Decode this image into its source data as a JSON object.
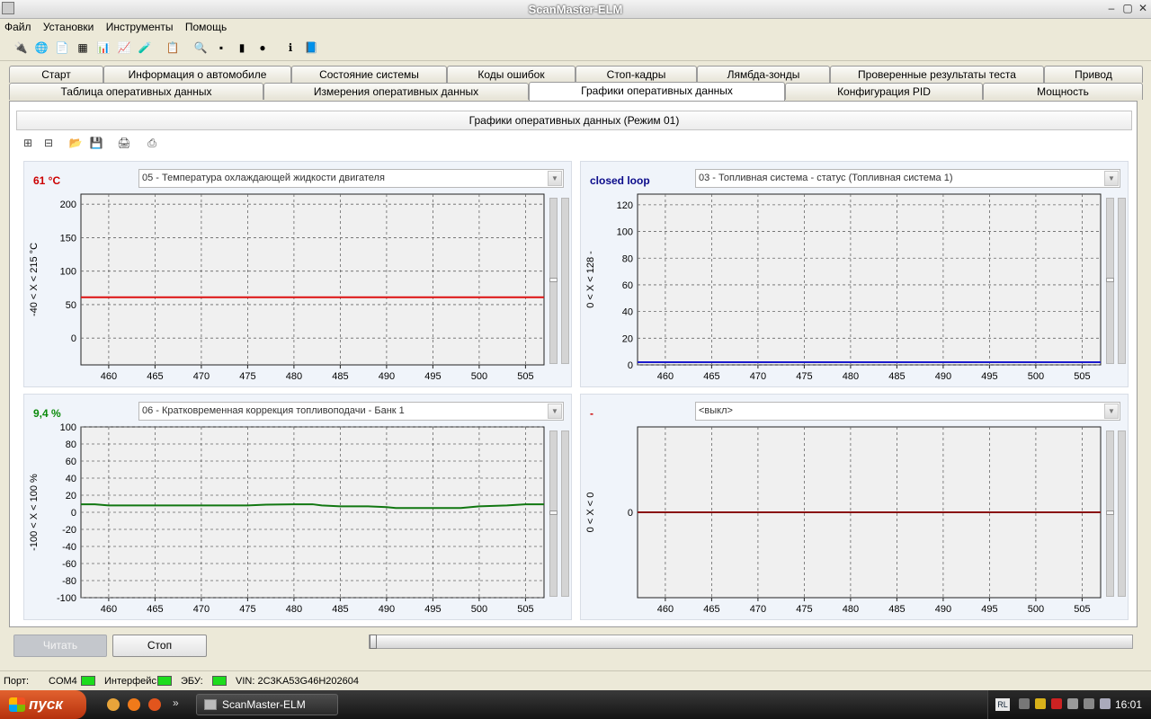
{
  "window": {
    "title": "ScanMaster-ELM"
  },
  "menu": [
    "Файл",
    "Установки",
    "Инструменты",
    "Помощь"
  ],
  "tabs_row1": [
    "Старт",
    "Информация о автомобиле",
    "Состояние системы",
    "Коды ошибок",
    "Стоп-кадры",
    "Лямбда-зонды",
    "Проверенные результаты теста",
    "Привод"
  ],
  "tabs_row2": [
    "Таблица оперативных данных",
    "Измерения оперативных данных",
    "Графики оперативных данных",
    "Конфигурация PID",
    "Мощность"
  ],
  "active_tab": "Графики оперативных данных",
  "panel_title": "Графики оперативных данных (Режим 01)",
  "x_ticks": [
    "460",
    "465",
    "470",
    "475",
    "480",
    "485",
    "490",
    "495",
    "500",
    "505"
  ],
  "graphs": [
    {
      "value": "61 °C",
      "value_color": "#cc0000",
      "pid": "05 - Температура охлаждающей жидкости двигателя",
      "range_label": "-40  < X <  215 °C",
      "y_ticks": [
        "200",
        "150",
        "100",
        "50",
        "0"
      ],
      "line_color": "#dd1111"
    },
    {
      "value": "closed loop",
      "value_color": "#0a0a8a",
      "pid": "03 - Топливная система - статус (Топливная система 1)",
      "range_label": "0  < X <  128  -",
      "y_ticks": [
        "120",
        "100",
        "80",
        "60",
        "40",
        "20",
        "0"
      ],
      "line_color": "#1a1acc"
    },
    {
      "value": "9,4 %",
      "value_color": "#0a8a0a",
      "pid": "06 - Кратковременная коррекция топливоподачи - Банк 1",
      "range_label": "-100  < X <  100  %",
      "y_ticks": [
        "100",
        "80",
        "60",
        "40",
        "20",
        "0",
        "-20",
        "-40",
        "-60",
        "-80",
        "-100"
      ],
      "line_color": "#117711"
    },
    {
      "value": "-",
      "value_color": "#cc0000",
      "pid": "<выкл>",
      "range_label": "0  < X <  0",
      "y_ticks": [
        "0"
      ],
      "line_color": "#8a1010"
    }
  ],
  "chart_data": [
    {
      "type": "line",
      "title": "05 - Температура охлаждающей жидкости двигателя",
      "ylabel": "-40  < X <  215 °C",
      "xlim": [
        457,
        507
      ],
      "ylim": [
        -40,
        215
      ],
      "grid": true,
      "series": [
        {
          "x": [
            457,
            507
          ],
          "values": [
            61,
            61
          ]
        }
      ]
    },
    {
      "type": "line",
      "title": "03 - Топливная система - статус (Топливная система 1)",
      "ylabel": "0  < X <  128  -",
      "xlim": [
        457,
        507
      ],
      "ylim": [
        0,
        128
      ],
      "grid": true,
      "series": [
        {
          "x": [
            457,
            507
          ],
          "values": [
            2,
            2
          ]
        }
      ]
    },
    {
      "type": "line",
      "title": "06 - Кратковременная коррекция топливоподачи - Банк 1",
      "ylabel": "-100  < X <  100  %",
      "xlim": [
        457,
        507
      ],
      "ylim": [
        -100,
        100
      ],
      "grid": true,
      "series": [
        {
          "x": [
            457,
            458.5,
            460,
            465,
            470,
            475,
            477,
            480,
            482,
            483,
            485,
            488,
            490,
            491,
            495,
            498,
            500,
            503,
            505,
            507
          ],
          "values": [
            9.4,
            9.4,
            8,
            8,
            8,
            8,
            9,
            9.4,
            9.4,
            8,
            7,
            7,
            6,
            5,
            5,
            5,
            7,
            8,
            9.4,
            9.4
          ]
        }
      ]
    },
    {
      "type": "line",
      "title": "<выкл>",
      "ylabel": "0  < X <  0",
      "xlim": [
        457,
        507
      ],
      "ylim": [
        -1,
        1
      ],
      "grid": true,
      "series": [
        {
          "x": [
            457,
            507
          ],
          "values": [
            0,
            0
          ]
        }
      ]
    }
  ],
  "buttons": {
    "read": "Читать",
    "stop": "Стоп"
  },
  "status": {
    "port_label": "Порт:",
    "port_value": "COM4",
    "interface_label": "Интерфейс:",
    "ecu_label": "ЭБУ:",
    "vin": "VIN: 2C3KA53G46H202604"
  },
  "taskbar": {
    "start": "пуск",
    "task": "ScanMaster-ELM",
    "lang": "RL",
    "clock": "16:01"
  }
}
